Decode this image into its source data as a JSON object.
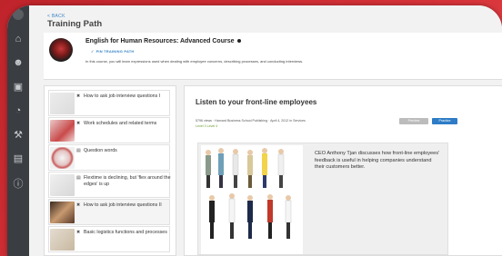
{
  "colors": {
    "brand_red": "#c0242b",
    "sidebar": "#3a3d42",
    "link_blue": "#3a86c8",
    "practice_blue": "#2e7cc6",
    "level_green": "#6a9b2f"
  },
  "sidebar": {
    "icons": [
      "logo-icon",
      "home-icon",
      "users-icon",
      "books-icon",
      "pie-chart-icon",
      "wrench-icon",
      "document-icon",
      "help-icon"
    ]
  },
  "header": {
    "back_label": "< BACK",
    "title": "Training Path"
  },
  "course": {
    "title": "English for Human Resources: Advanced Course",
    "pin_label": "PIN TRAINING PATH",
    "description": "In this course, you will learn expressions used when dealing with employee concerns, describing processes, and conducting interviews."
  },
  "lessons": [
    {
      "label": "How to ask job interview questions I",
      "icon": "tools-icon",
      "active": false
    },
    {
      "label": "Work schedules and related terms",
      "icon": "tools-icon",
      "active": false
    },
    {
      "label": "Question words",
      "icon": "document-icon",
      "active": false
    },
    {
      "label": "Flextime is declining, but 'flex around the edges' is up",
      "icon": "document-icon",
      "active": false
    },
    {
      "label": "How to ask job interview questions II",
      "icon": "tools-icon",
      "active": true
    },
    {
      "label": "Basic logistics functions and processes",
      "icon": "tools-icon",
      "active": false
    }
  ],
  "content": {
    "title": "Listen to your front-line employees",
    "meta": "5796 views · Harvard Business School Publishing · April 4, 2012 in Services",
    "level": "Level 3  Level 4",
    "preview_label": "Preview",
    "practice_label": "Practice",
    "caption": "CEO Anthony Tjan discusses how front-line employees' feedback is useful in helping companies understand their customers better."
  }
}
